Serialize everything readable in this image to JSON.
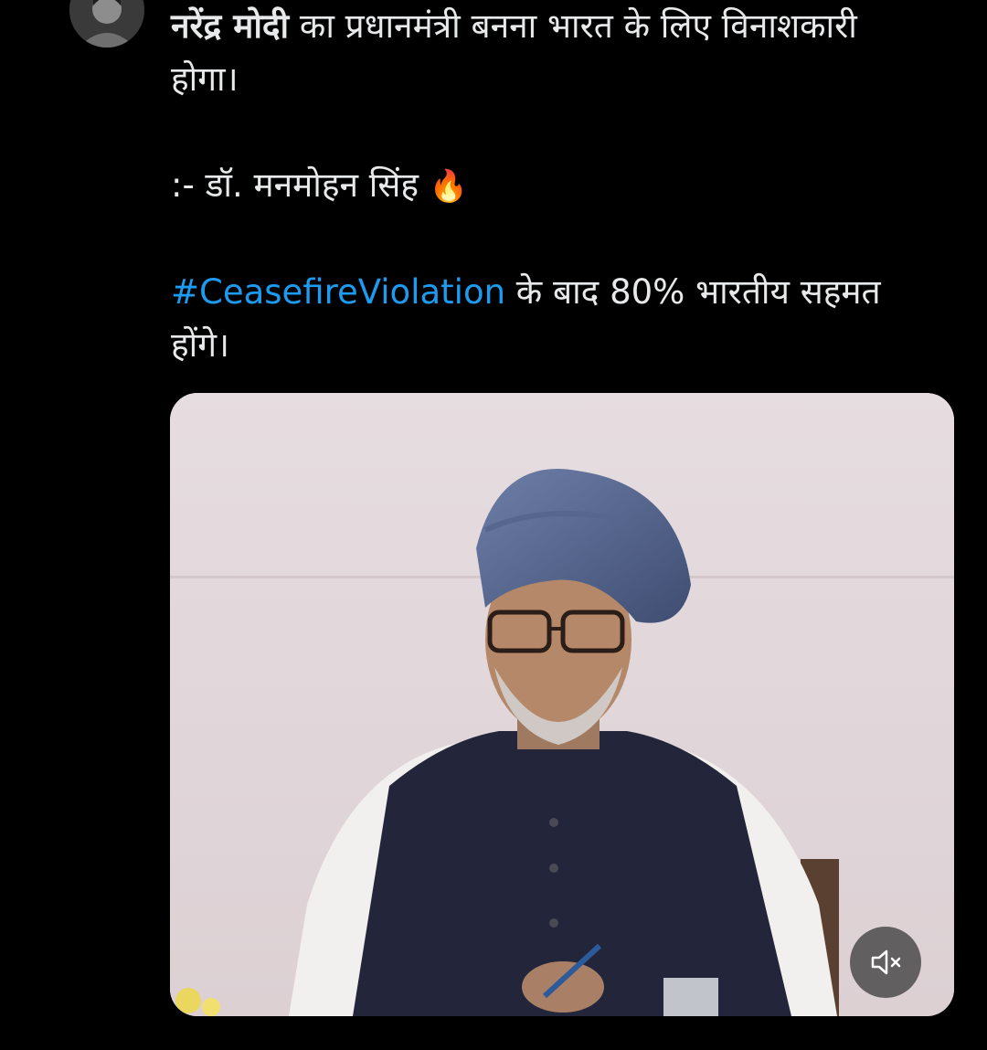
{
  "tweet": {
    "line1_bold": "नरेंद्र मोदी",
    "line1_rest": " का प्रधानमंत्री बनना भारत के लिए विनाशकारी होगा।",
    "attribution": ":- डॉ. मनमोहन सिंह ",
    "emoji": "🔥",
    "hashtag": "#CeasefireViolation",
    "closing": " के बाद 80% भारतीय सहमत होंगे।"
  },
  "media": {
    "type": "video",
    "mute_icon": "speaker-muted-icon"
  },
  "colors": {
    "background": "#000000",
    "text": "#e7e9ea",
    "hashtag": "#1d9bf0"
  }
}
